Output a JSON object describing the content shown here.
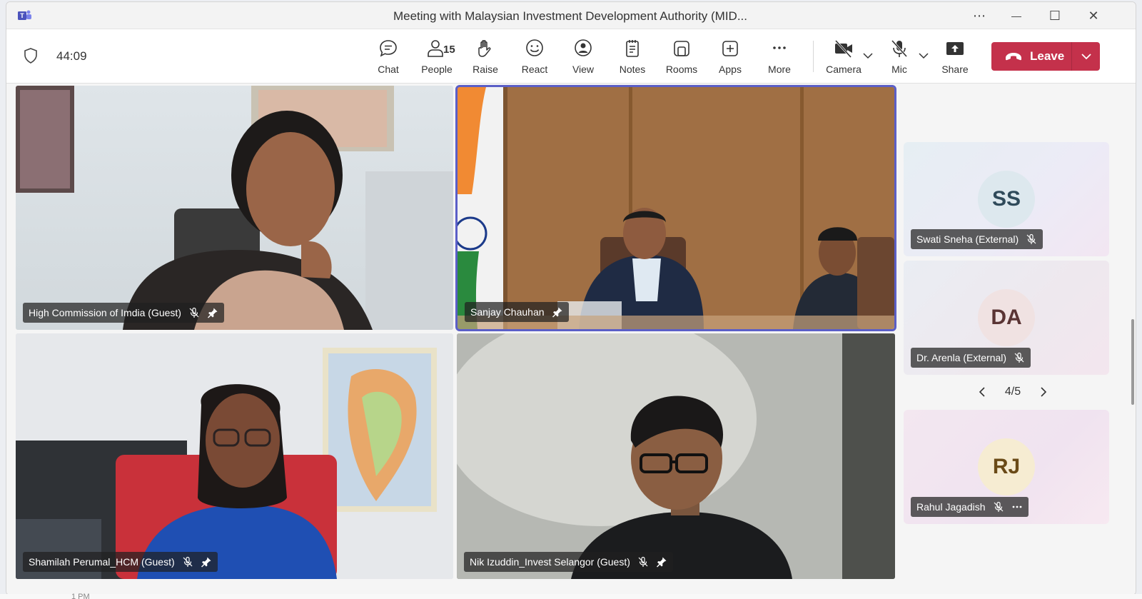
{
  "window": {
    "title": "Meeting with Malaysian Investment Development Authority (MID...",
    "controls": {
      "more": "⋯",
      "minimize": "—",
      "maximize": "☐",
      "close": "✕"
    }
  },
  "toolbar": {
    "timer": "44:09",
    "chat_label": "Chat",
    "people_label": "People",
    "people_count": "15",
    "raise_label": "Raise",
    "react_label": "React",
    "view_label": "View",
    "notes_label": "Notes",
    "rooms_label": "Rooms",
    "apps_label": "Apps",
    "more_label": "More",
    "camera_label": "Camera",
    "mic_label": "Mic",
    "share_label": "Share",
    "leave_label": "Leave"
  },
  "participants": {
    "video": [
      {
        "name": "High Commission of Imdia (Guest)"
      },
      {
        "name": "Sanjay Chauhan"
      },
      {
        "name": "Shamilah Perumal_HCM (Guest)"
      },
      {
        "name": "Nik Izuddin_Invest Selangor (Guest)"
      }
    ],
    "side": [
      {
        "initials": "SS",
        "name": "Swati Sneha (External)"
      },
      {
        "initials": "DA",
        "name": "Dr. Arenla (External)"
      },
      {
        "initials": "RJ",
        "name": "Rahul Jagadish"
      }
    ]
  },
  "pager": {
    "text": "4/5"
  },
  "background": {
    "calendar_hint": "1 PM"
  },
  "colors": {
    "accent": "#5b5fc7",
    "leave": "#c4314b"
  }
}
